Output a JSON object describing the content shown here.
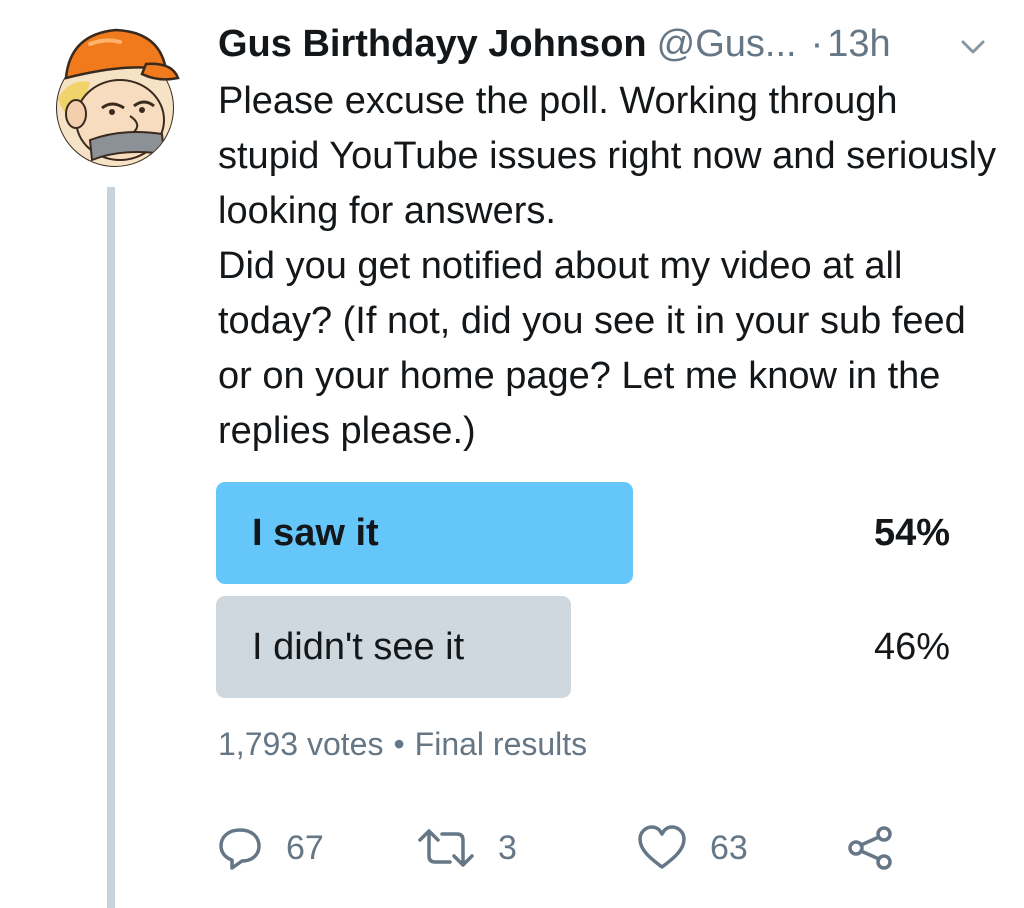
{
  "tweet": {
    "author_name": "Gus Birthdayy Johnson",
    "handle": "@Gus...",
    "separator": "·",
    "time": "13h",
    "text_lines": [
      "Please excuse the poll. Working through stupid YouTube issues right now and seriously looking for answers.",
      "Did you get notified about my video at all today? (If not, did you see it in your sub feed or on your home page? Let me know in the replies please.)"
    ]
  },
  "poll": {
    "options": [
      {
        "label": "I saw it",
        "percent_text": "54%",
        "fraction": 0.54,
        "winner": true,
        "bar_color": "#65c6fa"
      },
      {
        "label": "I didn't see it",
        "percent_text": "46%",
        "fraction": 0.46,
        "winner": false,
        "bar_color": "#cfd8de"
      }
    ],
    "votes": "1,793 votes",
    "bullet": "•",
    "status": "Final results"
  },
  "actions": {
    "replies": "67",
    "retweets": "3",
    "likes": "63"
  },
  "icons": {
    "avatar": "cartoon-avatar-orange-cap",
    "menu": "chevron-down-icon",
    "reply": "reply-icon",
    "retweet": "retweet-icon",
    "like": "heart-icon",
    "share": "share-icon"
  },
  "colors": {
    "text": "#14171a",
    "secondary": "#657786",
    "thread_line": "#c9d3db"
  }
}
